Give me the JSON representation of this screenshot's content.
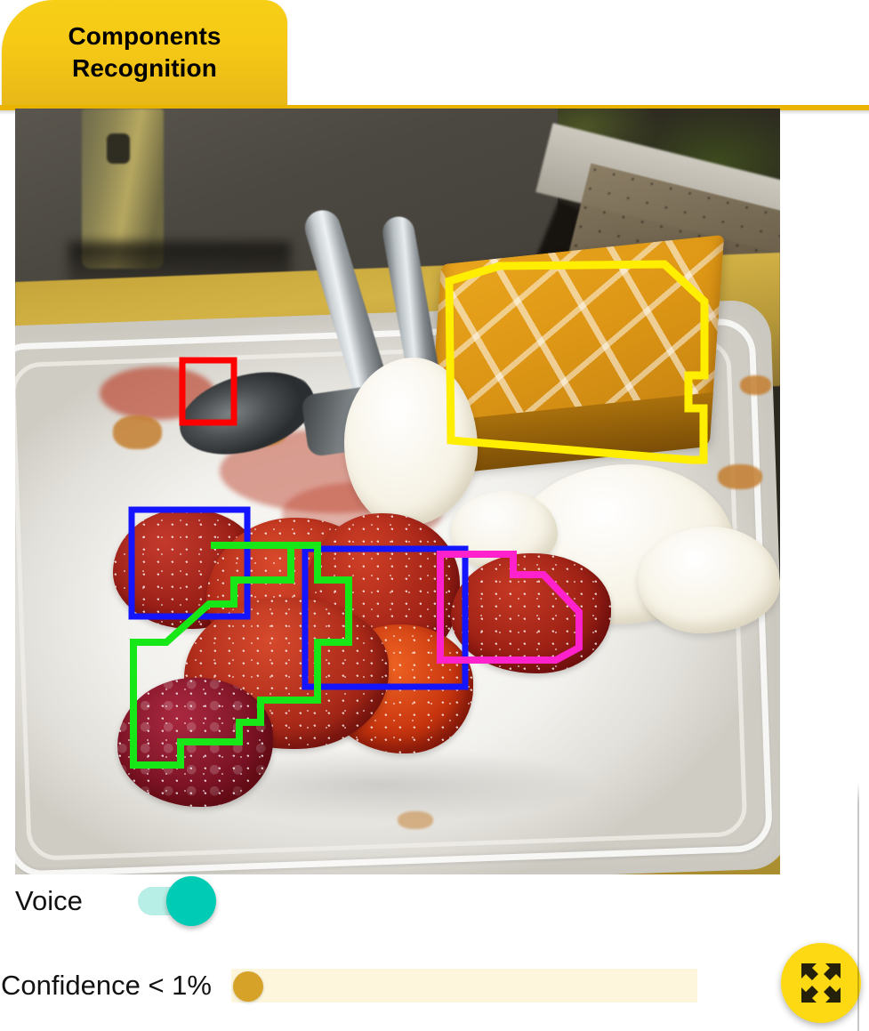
{
  "header": {
    "tab_label": "Components\nRecognition",
    "tab_color": "#f6c915",
    "underline_color": "#e8b400"
  },
  "photo": {
    "alt": "Dessert plate with waffle, strawberries, raspberry and whipped cream, spoon and fork on a white plate",
    "scene_description": "Close-up of a white rectangular plate on a yellow table at night, holding a sugar dusted waffle, several strawberries, a raspberry, dollops of whipped cream, a metal spoon and a metal fork; a dark mesh chair and foliage in the background"
  },
  "annotations": [
    {
      "id": "spoon-box",
      "label": "spoon",
      "shape": "rect",
      "color": "#ff0000",
      "color_name": "red"
    },
    {
      "id": "waffle-polygon",
      "label": "waffle",
      "shape": "polygon",
      "color": "#ffee00",
      "color_name": "yellow"
    },
    {
      "id": "strawberry-box-1",
      "label": "strawberry",
      "shape": "rect",
      "color": "#1414ff",
      "color_name": "blue"
    },
    {
      "id": "strawberry-box-2",
      "label": "strawberry",
      "shape": "rect",
      "color": "#1414ff",
      "color_name": "blue"
    },
    {
      "id": "berries-polygon",
      "label": "berries",
      "shape": "polygon",
      "color": "#17e617",
      "color_name": "green"
    },
    {
      "id": "strawberry-polygon",
      "label": "strawberry",
      "shape": "polygon",
      "color": "#ff22cc",
      "color_name": "magenta"
    }
  ],
  "controls": {
    "voice": {
      "label": "Voice",
      "toggle_state": "on",
      "track_color": "#b7eee5",
      "knob_color": "#00cbb4"
    },
    "confidence": {
      "label": "Confidence < 1%",
      "value_text": "< 1%",
      "slider_position_percent": 0,
      "track_color": "#fdf6dd",
      "thumb_color": "#d6a227"
    }
  },
  "fab": {
    "icon": "fullscreen-expand-icon",
    "background_color": "#fcd913",
    "icon_color": "#24200a"
  }
}
